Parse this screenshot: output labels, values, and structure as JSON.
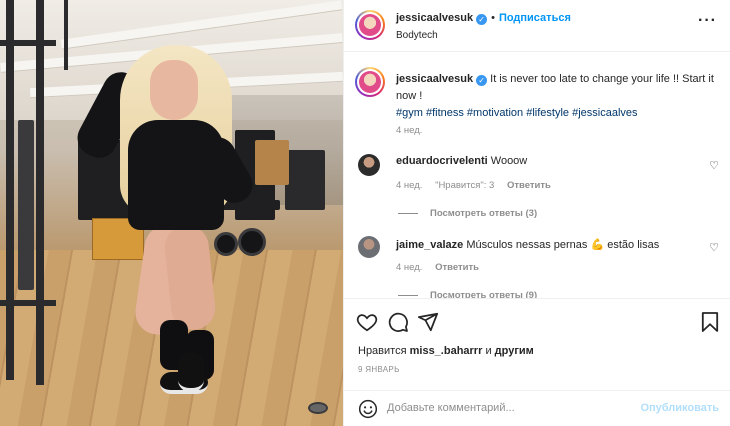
{
  "post": {
    "author": "jessicaalvesuk",
    "follow_label": "Подписаться",
    "location": "Bodytech",
    "more_icon": "more-horizontal-icon"
  },
  "caption": {
    "author": "jessicaalvesuk",
    "text": "It is never too late to change your life !! Start it now !",
    "hashtags": "#gym #fitness #motivation #lifestyle #jessicaalves",
    "time": "4 нед."
  },
  "comments": [
    {
      "username": "eduardocrivelenti",
      "text": "Wooow",
      "time": "4 нед.",
      "likes": "\"Нравится\": 3",
      "reply_label": "Ответить",
      "view_replies": "Посмотреть ответы (3)"
    },
    {
      "username": "jaime_valaze",
      "text": "Músculos nessas pernas",
      "emoji": "💪",
      "text_after": "estão lisas",
      "time": "4 нед.",
      "reply_label": "Ответить",
      "view_replies": "Посмотреть ответы (9)"
    }
  ],
  "actions": {
    "like_icon": "heart-icon",
    "comment_icon": "comment-icon",
    "share_icon": "share-icon",
    "save_icon": "bookmark-icon"
  },
  "likes": {
    "prefix": "Нравится",
    "user": "miss_.baharrr",
    "conjunction": "и",
    "suffix": "другим"
  },
  "date": "9 ЯНВАРЬ",
  "composer": {
    "placeholder": "Добавьте комментарий...",
    "publish_label": "Опубликовать"
  },
  "colors": {
    "link_blue": "#0095f6",
    "hashtag": "#00376b",
    "muted": "#8e8e8e",
    "publish_disabled": "#b2dffc"
  }
}
